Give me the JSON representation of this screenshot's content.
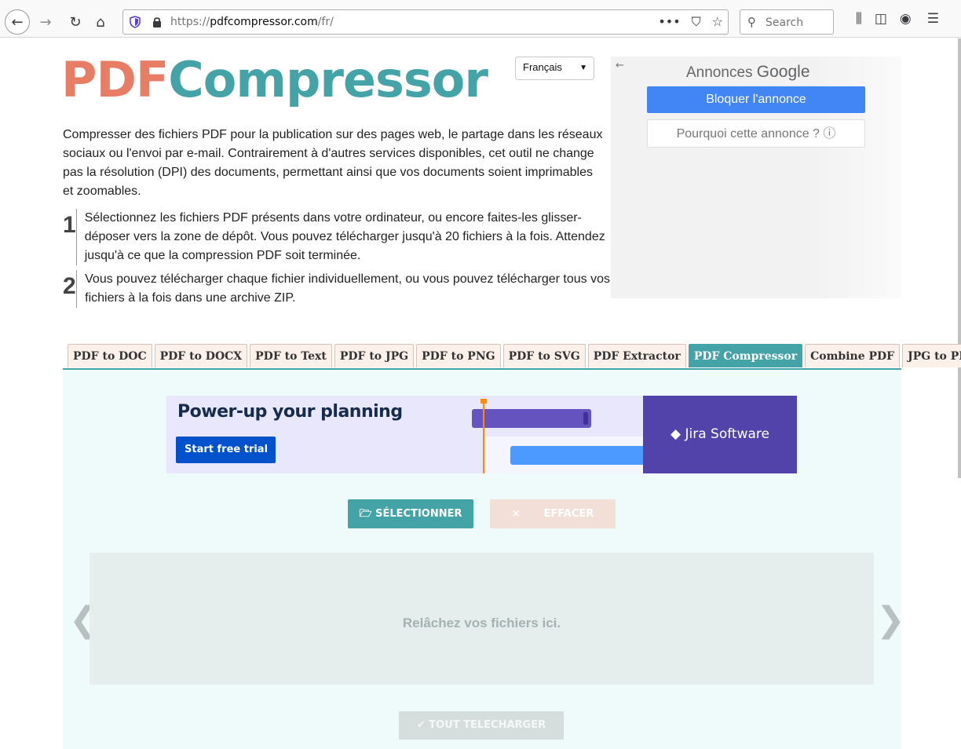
{
  "browser": {
    "url_prefix": "https://",
    "url_domain": "pdfcompressor.com",
    "url_path": "/fr/",
    "search_placeholder": "Search",
    "icons": [
      "back-icon",
      "forward-icon",
      "reload-icon",
      "home-icon",
      "tracking-shield-icon",
      "lock-icon",
      "page-actions-icon",
      "pocket-icon",
      "bookmark-star-icon",
      "search-icon",
      "library-icon",
      "sidebar-icon",
      "account-icon",
      "menu-icon"
    ]
  },
  "header": {
    "logo_pdf": "PDF",
    "logo_compressor": "Compressor",
    "language": "Français"
  },
  "intro": {
    "text": "Compresser des fichiers PDF pour la publication sur des pages web, le partage dans les réseaux sociaux ou l'envoi par e-mail. Contrairement à d'autres services disponibles, cet outil ne change pas la résolution (DPI) des documents, permettant ainsi que vos documents soient imprimables et zoomables."
  },
  "steps": [
    {
      "num": "1",
      "text": "Sélectionnez les fichiers PDF présents dans votre ordinateur, ou encore faites-les glisser-déposer vers la zone de dépôt. Vous pouvez télécharger jusqu'à 20 fichiers à la fois. Attendez jusqu'à ce que la compression PDF soit terminée."
    },
    {
      "num": "2",
      "text": "Vous pouvez télécharger chaque fichier individuellement, ou vous pouvez télécharger tous vos fichiers à la fois dans une archive ZIP."
    }
  ],
  "google_ad": {
    "label_prefix": "Annonces",
    "label_brand": "Google",
    "block_button": "Bloquer l'annonce",
    "why_button": "Pourquoi cette annonce ? ⓘ"
  },
  "tabs": [
    {
      "label": "PDF to DOC",
      "active": false
    },
    {
      "label": "PDF to DOCX",
      "active": false
    },
    {
      "label": "PDF to Text",
      "active": false
    },
    {
      "label": "PDF to JPG",
      "active": false
    },
    {
      "label": "PDF to PNG",
      "active": false
    },
    {
      "label": "PDF to SVG",
      "active": false
    },
    {
      "label": "PDF Extractor",
      "active": false
    },
    {
      "label": "PDF Compressor",
      "active": true
    },
    {
      "label": "Combine PDF",
      "active": false
    },
    {
      "label": "JPG to PDF",
      "active": false
    }
  ],
  "jira_ad": {
    "headline": "Power-up your planning",
    "cta": "Start free trial",
    "brand": "Jira Software"
  },
  "actions": {
    "select_label": "SÉLECTIONNER",
    "clear_label": "EFFACER",
    "dropzone_text": "Relâchez vos fichiers ici.",
    "download_all_label": "TOUT TELECHARGER",
    "prev": "❮",
    "next": "❯"
  },
  "colors": {
    "accent_teal": "#43a3a6",
    "logo_orange": "#e77d65",
    "google_blue": "#4285f4",
    "jira_purple": "#5243aa"
  }
}
